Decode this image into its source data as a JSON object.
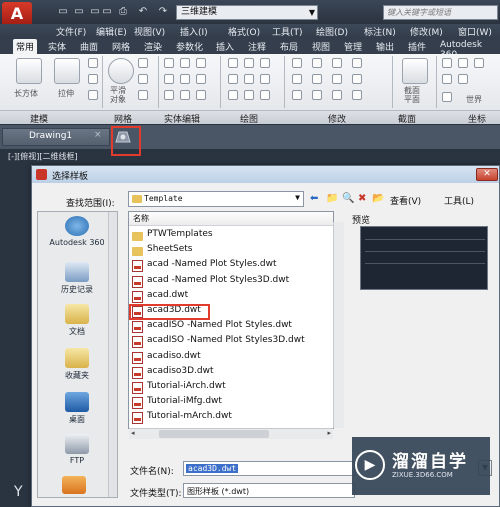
{
  "titlebar": {
    "app_button": "A",
    "quick_access": [
      "▭",
      "▭",
      "▭",
      "▭",
      "⎙",
      "↶",
      "↷"
    ],
    "workspace": "三维建模",
    "search_placeholder": "键入关键字或短语"
  },
  "menubar": [
    "文件(F)",
    "编辑(E)",
    "视图(V)",
    "插入(I)",
    "格式(O)",
    "工具(T)",
    "绘图(D)",
    "标注(N)",
    "修改(M)",
    "窗口(W)"
  ],
  "ribbon_tabs": [
    "常用",
    "实体",
    "曲面",
    "网格",
    "渲染",
    "参数化",
    "插入",
    "注释",
    "布局",
    "视图",
    "管理",
    "输出",
    "插件",
    "Autodesk 360"
  ],
  "ribbon_labels": {
    "box": "长方体",
    "extrude": "拉伸",
    "smooth": "平滑\n对象",
    "section": "截面\n平面",
    "world": "世界"
  },
  "panels": [
    "建模",
    "网格",
    "实体编辑",
    "绘图",
    "修改",
    "截面",
    "坐标"
  ],
  "document": {
    "tab_label": "Drawing1",
    "close": "×",
    "view_label": "[-][俯视][二维线框]",
    "ucs_glyph": "Y"
  },
  "dialog": {
    "title": "选择样板",
    "close": "✕",
    "look_in_label": "查找范围(I):",
    "look_in_value": "Template",
    "toolbar": {
      "back": "⬅",
      "up": "📁",
      "search": "🔍",
      "delete": "✖",
      "new_folder": "📂",
      "views": "查看(V)",
      "tools": "工具(L)"
    },
    "places": [
      "Autodesk 360",
      "历史记录",
      "文档",
      "收藏夹",
      "桌面",
      "FTP"
    ],
    "column_name": "名称",
    "files": [
      {
        "name": "PTWTemplates",
        "kind": "folder"
      },
      {
        "name": "SheetSets",
        "kind": "folder"
      },
      {
        "name": "acad -Named Plot Styles.dwt",
        "kind": "dwt"
      },
      {
        "name": "acad -Named Plot Styles3D.dwt",
        "kind": "dwt"
      },
      {
        "name": "acad.dwt",
        "kind": "dwt"
      },
      {
        "name": "acad3D.dwt",
        "kind": "dwt"
      },
      {
        "name": "acadISO -Named Plot Styles.dwt",
        "kind": "dwt"
      },
      {
        "name": "acadISO -Named Plot Styles3D.dwt",
        "kind": "dwt"
      },
      {
        "name": "acadiso.dwt",
        "kind": "dwt"
      },
      {
        "name": "acadiso3D.dwt",
        "kind": "dwt"
      },
      {
        "name": "Tutorial-iArch.dwt",
        "kind": "dwt"
      },
      {
        "name": "Tutorial-iMfg.dwt",
        "kind": "dwt"
      },
      {
        "name": "Tutorial-mArch.dwt",
        "kind": "dwt"
      }
    ],
    "preview_label": "预览",
    "file_name_label": "文件名(N):",
    "file_name_value": "acad3D.dwt",
    "file_type_label": "文件类型(T):",
    "file_type_value": "图形样板 (*.dwt)"
  },
  "watermark": {
    "logo": "▶",
    "name_cn": "溜溜自学",
    "name_en": "ZIXUE.3D66.COM"
  },
  "colors": {
    "highlight_box": "#e23b2e",
    "app_button": "#c9372a",
    "title_bar": "#2b3340"
  }
}
